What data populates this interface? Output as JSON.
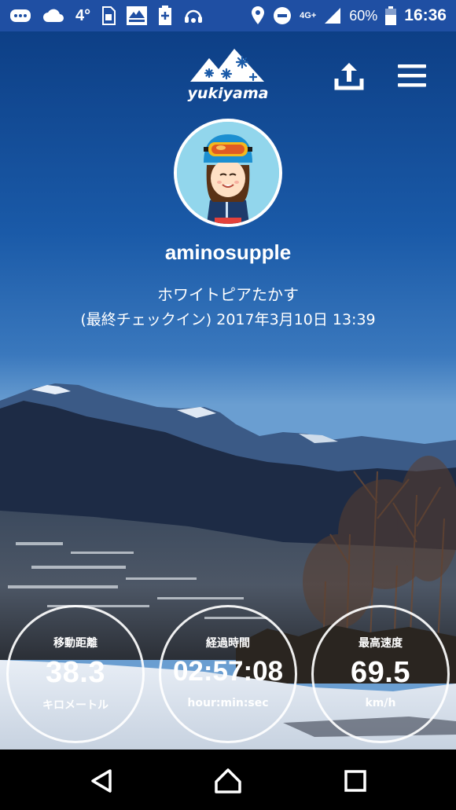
{
  "status_bar": {
    "temperature": "4°",
    "network": "4G+",
    "battery": "60%",
    "time": "16:36",
    "icons": [
      "messages-icon",
      "cloud-icon",
      "sim-icon",
      "yukiyama-app-icon",
      "battery-plus-icon",
      "headset-icon",
      "location-icon",
      "do-not-disturb-icon",
      "signal-icon",
      "battery-icon"
    ]
  },
  "header": {
    "logo_text": "yukiyama",
    "share_icon": "share-upload-icon",
    "menu_icon": "hamburger-menu-icon"
  },
  "profile": {
    "username": "aminosupple",
    "resort": "ホワイトピアたかす",
    "last_checkin": "(最終チェックイン) 2017年3月10日 13:39"
  },
  "stats": [
    {
      "label": "移動距離",
      "value": "38.3",
      "unit": "キロメートル"
    },
    {
      "label": "経過時間",
      "value": "02:57:08",
      "unit": "hour:min:sec"
    },
    {
      "label": "最高速度",
      "value": "69.5",
      "unit": "km/h"
    }
  ],
  "nav": {
    "icons": [
      "back-icon",
      "home-icon",
      "recents-icon"
    ]
  }
}
